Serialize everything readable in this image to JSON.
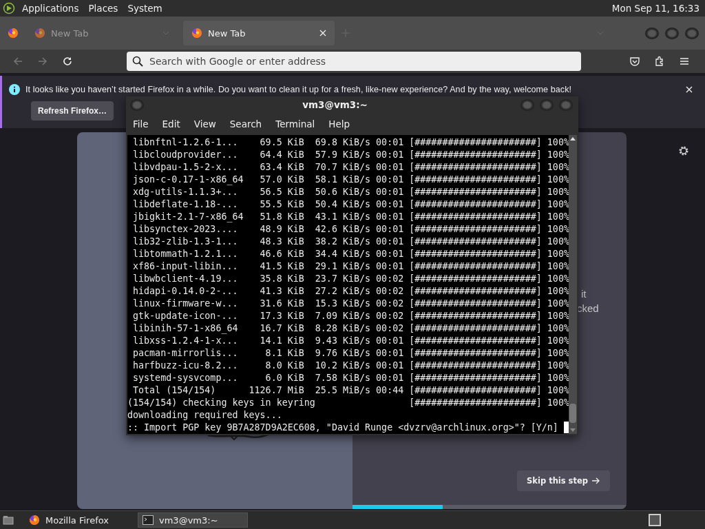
{
  "top_panel": {
    "menus": [
      "Applications",
      "Places",
      "System"
    ],
    "clock": "Mon Sep 11, 16:33"
  },
  "browser": {
    "tabs": [
      {
        "label": "New Tab",
        "selected": false
      },
      {
        "label": "New Tab",
        "selected": true
      }
    ],
    "nav": {
      "back_disabled": true,
      "forward_disabled": true
    },
    "address_bar": {
      "placeholder": "Search with Google or enter address"
    },
    "notification": {
      "message": "It looks like you haven’t started Firefox in a while. Do you want to clean it up for a fresh, like-new experience? And by the way, welcome back!",
      "button": "Refresh Firefox…"
    },
    "onboarding": {
      "fragments": [
        "it",
        "cked"
      ],
      "skip_button": "Skip this step",
      "progress": {
        "level": 0.33
      }
    }
  },
  "terminal": {
    "title": "vm3@vm3:~",
    "menu": [
      "File",
      "Edit",
      "View",
      "Search",
      "Terminal",
      "Help"
    ],
    "lines": [
      " libnftnl-1.2.6-1...    69.5 KiB  69.8 KiB/s 00:01 [######################] 100%",
      " libcloudprovider...    64.4 KiB  57.9 KiB/s 00:01 [######################] 100%",
      " libvdpau-1.5-2-x...    63.4 KiB  70.7 KiB/s 00:01 [######################] 100%",
      " json-c-0.17-1-x86_64   57.0 KiB  58.1 KiB/s 00:01 [######################] 100%",
      " xdg-utils-1.1.3+...    56.5 KiB  50.6 KiB/s 00:01 [######################] 100%",
      " libdeflate-1.18-...    55.5 KiB  50.4 KiB/s 00:01 [######################] 100%",
      " jbigkit-2.1-7-x86_64   51.8 KiB  43.1 KiB/s 00:01 [######################] 100%",
      " libsynctex-2023....    48.9 KiB  42.6 KiB/s 00:01 [######################] 100%",
      " lib32-zlib-1.3-1...    48.3 KiB  38.2 KiB/s 00:01 [######################] 100%",
      " libtommath-1.2.1...    46.6 KiB  34.4 KiB/s 00:01 [######################] 100%",
      " xf86-input-libin...    41.5 KiB  29.1 KiB/s 00:01 [######################] 100%",
      " libwbclient-4.19...    35.8 KiB  23.7 KiB/s 00:02 [######################] 100%",
      " hidapi-0.14.0-2-...    41.3 KiB  27.2 KiB/s 00:02 [######################] 100%",
      " linux-firmware-w...    31.6 KiB  15.3 KiB/s 00:02 [######################] 100%",
      " gtk-update-icon-...    17.3 KiB  7.09 KiB/s 00:02 [######################] 100%",
      " libinih-57-1-x86_64    16.7 KiB  8.28 KiB/s 00:02 [######################] 100%",
      " libxss-1.2.4-1-x...    14.1 KiB  9.43 KiB/s 00:01 [######################] 100%",
      " pacman-mirrorlis...     8.1 KiB  9.76 KiB/s 00:01 [######################] 100%",
      " harfbuzz-icu-8.2...     8.0 KiB  10.2 KiB/s 00:01 [######################] 100%",
      " systemd-sysvcomp...     6.0 KiB  7.58 KiB/s 00:01 [######################] 100%",
      " Total (154/154)      1126.7 MiB  25.5 MiB/s 00:44 [######################] 100%",
      "(154/154) checking keys in keyring                 [######################] 100%",
      "downloading required keys...",
      ":: Import PGP key 9B7A287D9A2EC608, \"David Runge <dvzrv@archlinux.org>\"? [Y/n] "
    ]
  },
  "taskbar": {
    "tasks": [
      {
        "label": "Mozilla Firefox",
        "kind": "browser",
        "selected": false
      },
      {
        "label": "vm3@vm3:~",
        "kind": "terminal",
        "selected": true
      }
    ]
  }
}
